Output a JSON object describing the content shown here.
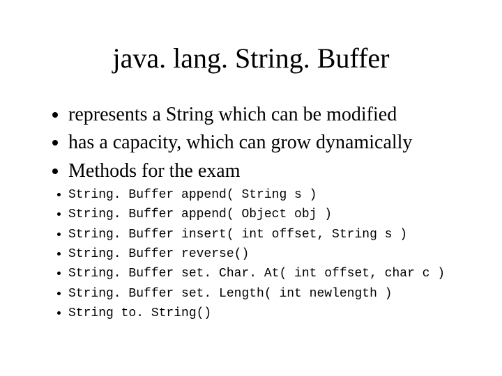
{
  "title": "java. lang. String. Buffer",
  "bullets_main": [
    "represents a String which can be modified",
    "has a capacity, which can grow dynamically",
    "Methods for the exam"
  ],
  "bullets_methods": [
    "String. Buffer append( String s )",
    "String. Buffer append( Object obj )",
    "String. Buffer insert( int offset, String s )",
    "String. Buffer reverse()",
    "String. Buffer set. Char. At( int offset, char c )",
    "String. Buffer set. Length( int newlength )",
    "String to. String()"
  ]
}
